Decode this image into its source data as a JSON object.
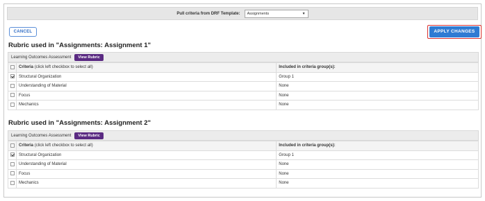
{
  "template_bar": {
    "label": "Pull criteria from DRF Template:",
    "selected": "Assignments"
  },
  "actions": {
    "cancel_label": "CANCEL",
    "apply_label": "APPLY CHANGES"
  },
  "rubrics": [
    {
      "title": "Rubric used in \"Assignments: Assignment 1\"",
      "outcome": "Learning Outcomes Assessment",
      "view_label": "View Rubric",
      "header_criteria": "Criteria",
      "header_hint": "(click left checkbox to select all)",
      "header_included": "Included in criteria group(s):",
      "rows": [
        {
          "criteria": "Structural Organization",
          "group": "Group 1",
          "checked": true
        },
        {
          "criteria": "Understanding of Material",
          "group": "None",
          "checked": false
        },
        {
          "criteria": "Focus",
          "group": "None",
          "checked": false
        },
        {
          "criteria": "Mechanics",
          "group": "None",
          "checked": false
        }
      ]
    },
    {
      "title": "Rubric used in \"Assignments: Assignment 2\"",
      "outcome": "Learning Outcomes Assessment",
      "view_label": "View Rubric",
      "header_criteria": "Criteria",
      "header_hint": "(click left checkbox to select all)",
      "header_included": "Included in criteria group(s):",
      "rows": [
        {
          "criteria": "Structural Organization",
          "group": "Group 1",
          "checked": true
        },
        {
          "criteria": "Understanding of Material",
          "group": "None",
          "checked": false
        },
        {
          "criteria": "Focus",
          "group": "None",
          "checked": false
        },
        {
          "criteria": "Mechanics",
          "group": "None",
          "checked": false
        }
      ]
    }
  ],
  "colors": {
    "accent": "#2f7bd3",
    "view_rubric": "#5a2a82",
    "highlight": "#d9302f"
  }
}
